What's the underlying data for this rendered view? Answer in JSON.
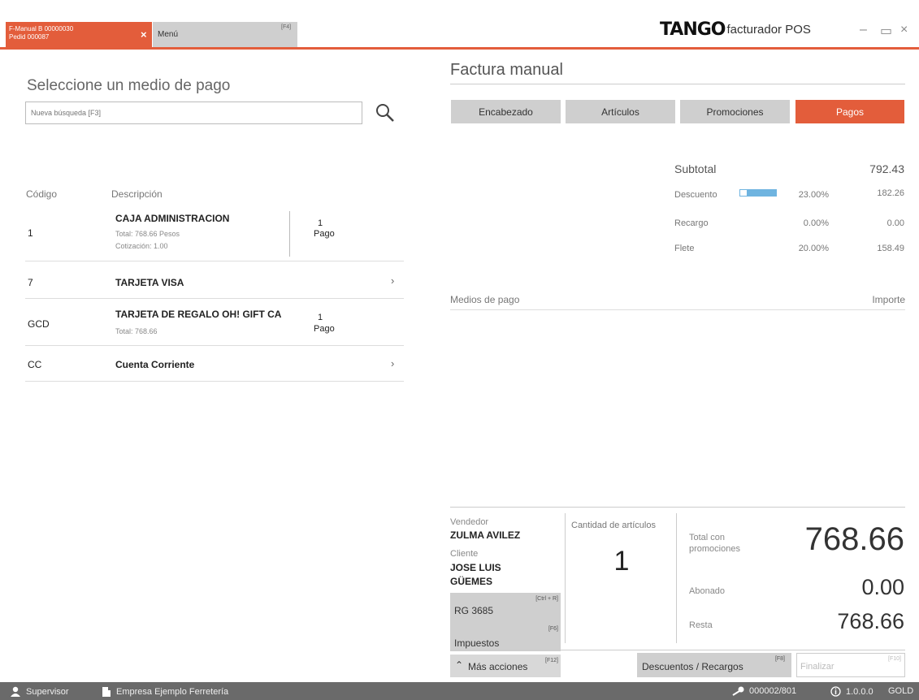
{
  "titlebar": {
    "active_tab_line1": "F-Manual B 00000030",
    "active_tab_line2": "Pedid 000087",
    "active_tab_close": "×",
    "menu_tab_label": "Menú",
    "menu_tab_key": "[F4]",
    "brand_logo": "TANGO",
    "brand_product": "facturador POS",
    "minimize": "–",
    "maximize": "▭",
    "close": "×"
  },
  "left": {
    "heading": "Seleccione un medio de pago",
    "search_placeholder": "Nueva búsqueda [F3]",
    "col_code": "Código",
    "col_desc": "Descripción",
    "rows": [
      {
        "code": "1",
        "name": "CAJA ADMINISTRACION",
        "sub1": "Total:  768.66   Pesos",
        "sub2": "Cotización:  1.00",
        "pay_n": "1",
        "pay_l": "Pago"
      },
      {
        "code": "7",
        "name": "TARJETA VISA",
        "chev": "›"
      },
      {
        "code": "GCD",
        "name": "TARJETA DE REGALO OH! GIFT CARD",
        "sub1": "Total:  768.66",
        "pay_n": "1",
        "pay_l": "Pago"
      },
      {
        "code": "CC",
        "name": "Cuenta Corriente",
        "chev": "›"
      }
    ]
  },
  "right": {
    "title": "Factura manual",
    "tabs": [
      "Encabezado",
      "Artículos",
      "Promociones",
      "Pagos"
    ],
    "subtotal_label": "Subtotal",
    "subtotal_value": "792.43",
    "descuento_label": "Descuento",
    "descuento_pct": "23.00%",
    "descuento_value": "182.26",
    "recargo_label": "Recargo",
    "recargo_pct": "0.00%",
    "recargo_value": "0.00",
    "flete_label": "Flete",
    "flete_pct": "20.00%",
    "flete_value": "158.49",
    "medios_label": "Medios de pago",
    "importe_label": "Importe"
  },
  "bottom": {
    "vendedor_label": "Vendedor",
    "vendedor_value": "ZULMA AVILEZ",
    "cliente_label": "Cliente",
    "cliente_value1": "JOSE LUIS",
    "cliente_value2": "GÜEMES",
    "rg_label": "RG 3685",
    "rg_key": "[Ctrl + R]",
    "impuestos_label": "Impuestos",
    "impuestos_key": "[F6]",
    "mas_acciones": "Más acciones",
    "mas_acciones_key": "[F12]",
    "cantidad_label": "Cantidad de artículos",
    "cantidad_value": "1",
    "total_label1": "Total con",
    "total_label2": "promociones",
    "total_value": "768.66",
    "abonado_label": "Abonado",
    "abonado_value": "0.00",
    "resta_label": "Resta",
    "resta_value": "768.66",
    "descuentos_btn": "Descuentos / Recargos",
    "descuentos_key": "[F8]",
    "finalizar": "Finalizar",
    "finalizar_key": "[F10]"
  },
  "status": {
    "user": "Supervisor",
    "company": "Empresa Ejemplo Ferretería",
    "terminal": "000002/801",
    "version": "1.0.0.0",
    "edition": "GOLD"
  }
}
